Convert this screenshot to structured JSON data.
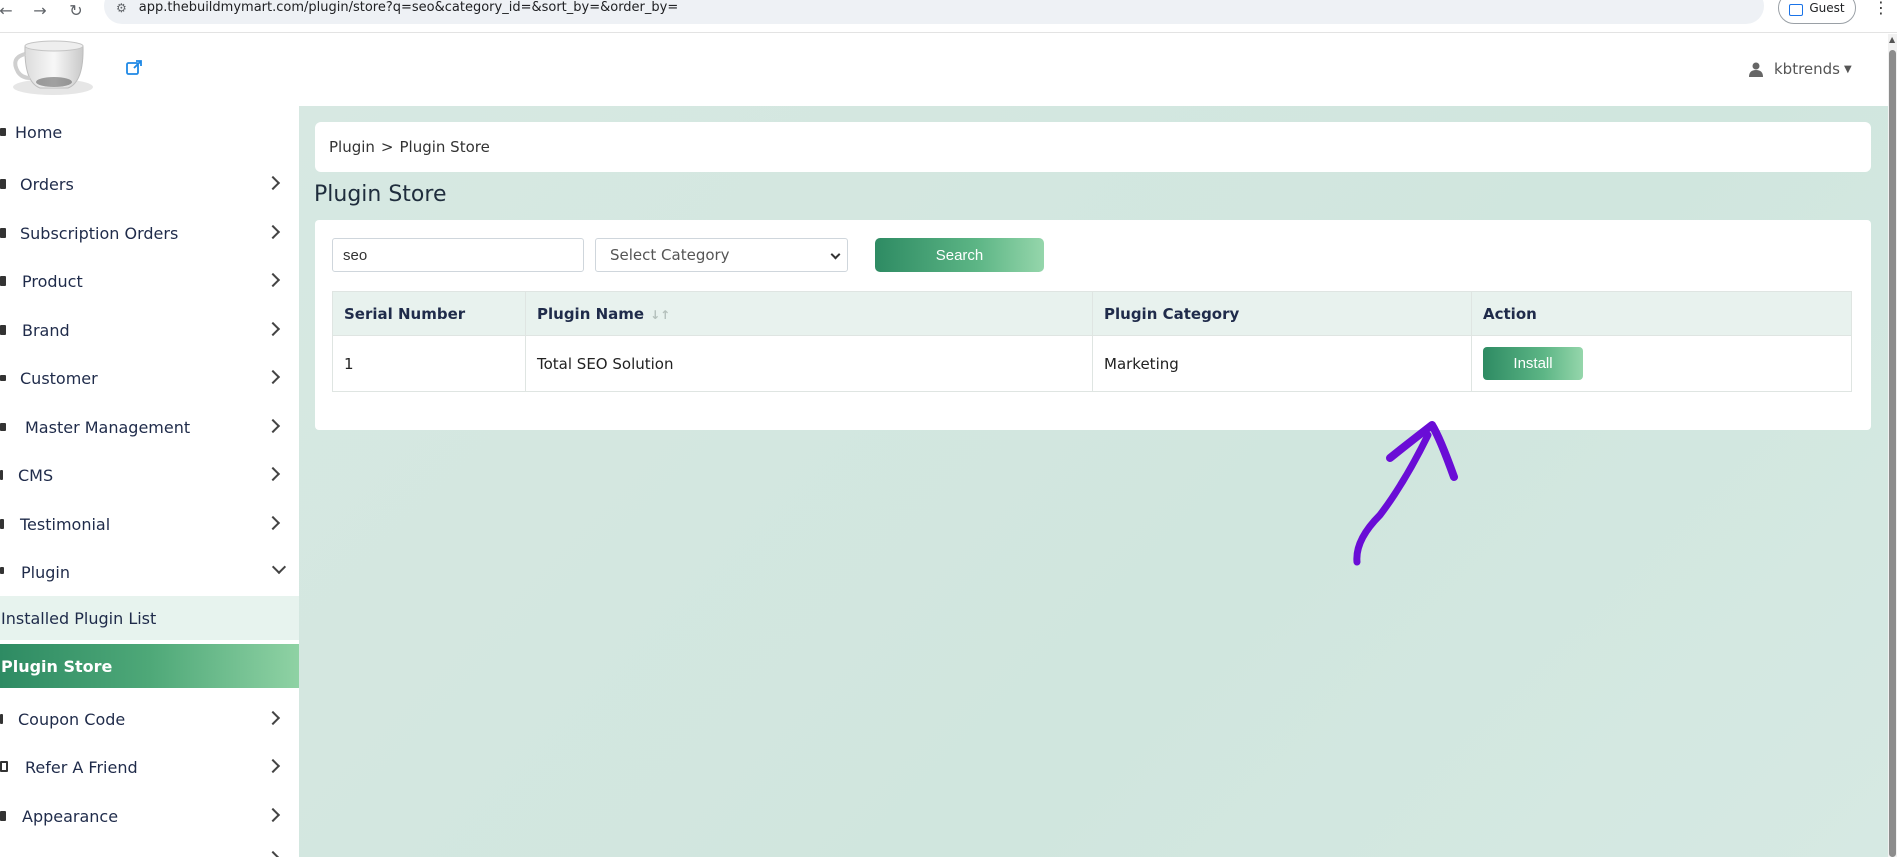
{
  "browser": {
    "back_icon": "arrow-left-icon",
    "forward_icon": "arrow-right-icon",
    "reload_icon": "reload-icon",
    "url": "app.thebuildmymart.com/plugin/store?q=seo&category_id=&sort_by=&order_by=",
    "profile_label": "Guest"
  },
  "header": {
    "username": "kbtrends"
  },
  "sidebar": {
    "items": [
      {
        "label": "Home"
      },
      {
        "label": "Orders"
      },
      {
        "label": "Subscription Orders"
      },
      {
        "label": "Product"
      },
      {
        "label": "Brand"
      },
      {
        "label": "Customer"
      },
      {
        "label": "Master Management"
      },
      {
        "label": "CMS"
      },
      {
        "label": "Testimonial"
      },
      {
        "label": "Plugin"
      },
      {
        "label": "Coupon Code"
      },
      {
        "label": "Refer A Friend"
      },
      {
        "label": "Appearance"
      }
    ],
    "plugin_sub": [
      {
        "label": "Installed Plugin List"
      },
      {
        "label": "Plugin Store"
      }
    ]
  },
  "breadcrumb": {
    "parent": "Plugin",
    "separator": ">",
    "current": "Plugin Store"
  },
  "page": {
    "title": "Plugin Store"
  },
  "filters": {
    "search_value": "seo",
    "category_selected": "Select Category",
    "search_button": "Search"
  },
  "table": {
    "headers": [
      "Serial Number",
      "Plugin Name",
      "Plugin Category",
      "Action"
    ],
    "rows": [
      {
        "serial": "1",
        "name": "Total SEO Solution",
        "category": "Marketing",
        "action": "Install"
      }
    ]
  },
  "colors": {
    "accent_start": "#2e8b63",
    "accent_end": "#95d6ab",
    "annotation": "#6a0dd6"
  }
}
